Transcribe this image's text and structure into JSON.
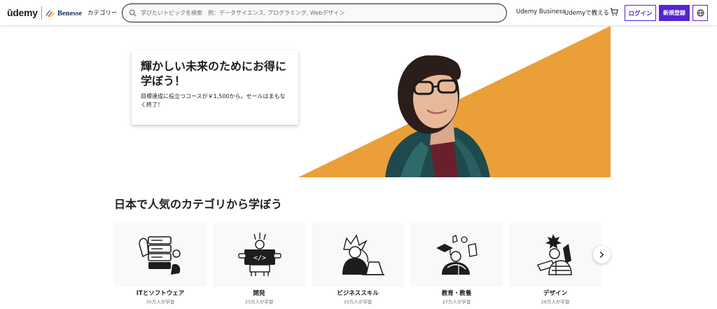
{
  "header": {
    "logo": "ūdemy",
    "partner_logo": "Benesse",
    "categories_label": "カテゴリー",
    "search_placeholder": "学びたいトピックを検索　例：データサイエンス, プログラミング, Webデザイン",
    "udemy_business": "Udemy Business",
    "teach": "Udemyで教える",
    "login": "ログイン",
    "signup": "新規登録",
    "icons": {
      "search": "search-icon",
      "cart": "cart-icon",
      "language": "globe-icon"
    }
  },
  "hero": {
    "title": "輝かしい未来のためにお得に学ぼう！",
    "subtitle": "目標達成に役立つコースが￥1,500から。セールはまもなく終了！",
    "accent_color": "#eb9f39"
  },
  "categories_section": {
    "title": "日本で人気のカテゴリから学ぼう",
    "items": [
      {
        "name": "ITとソフトウェア",
        "learners": "35万人が学習",
        "icon": "server-illustration"
      },
      {
        "name": "開発",
        "learners": "33万人が学習",
        "icon": "code-laptop-illustration"
      },
      {
        "name": "ビジネススキル",
        "learners": "33万人が学習",
        "icon": "business-person-illustration"
      },
      {
        "name": "教育・教養",
        "learners": "27万人が学習",
        "icon": "education-illustration"
      },
      {
        "name": "デザイン",
        "learners": "26万人が学習",
        "icon": "design-illustration"
      }
    ],
    "next_icon": "chevron-right-icon"
  },
  "colors": {
    "brand_purple": "#5624d0",
    "text": "#1c1d1f",
    "muted": "#6a6f73",
    "card_bg": "#f7f9fa"
  }
}
